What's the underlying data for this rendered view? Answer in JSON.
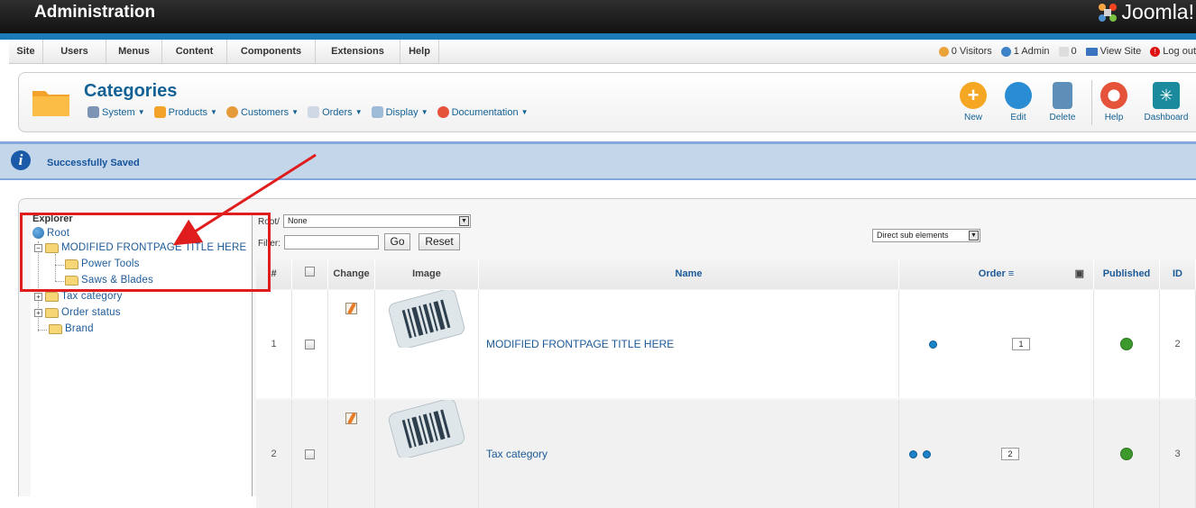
{
  "header": {
    "title": "Administration",
    "logo_text": "Joomla!"
  },
  "menu": {
    "items": [
      "Site",
      "Users",
      "Menus",
      "Content",
      "Components",
      "Extensions",
      "Help"
    ]
  },
  "status": {
    "visitors": "0 Visitors",
    "admins": "1 Admin",
    "messages": "0",
    "view_site": "View Site",
    "logout": "Log out"
  },
  "page": {
    "title": "Categories",
    "submenu": [
      {
        "label": "System",
        "icon": "tools-icon"
      },
      {
        "label": "Products",
        "icon": "products-icon"
      },
      {
        "label": "Customers",
        "icon": "customers-icon"
      },
      {
        "label": "Orders",
        "icon": "orders-icon"
      },
      {
        "label": "Display",
        "icon": "display-icon"
      },
      {
        "label": "Documentation",
        "icon": "help-ring-icon"
      }
    ],
    "toolbar": {
      "new": "New",
      "edit": "Edit",
      "delete": "Delete",
      "help": "Help",
      "dashboard": "Dashboard"
    }
  },
  "message": {
    "text": "Successfully Saved"
  },
  "explorer": {
    "title": "Explorer",
    "root": "Root",
    "nodes": [
      "MODIFIED FRONTPAGE TITLE HERE",
      "Power Tools",
      "Saws & Blades",
      "Tax category",
      "Order status",
      "Brand"
    ]
  },
  "controls": {
    "root_label": "Root/",
    "root_select": "None",
    "filter_label": "Filter:",
    "filter_value": "",
    "go": "Go",
    "reset": "Reset",
    "scope_select": "Direct sub elements"
  },
  "grid": {
    "headers": {
      "num": "#",
      "change": "Change",
      "image": "Image",
      "name": "Name",
      "order": "Order",
      "published": "Published",
      "id": "ID"
    },
    "rows": [
      {
        "num": "1",
        "name": "MODIFIED FRONTPAGE TITLE HERE",
        "order": "1",
        "id": "2"
      },
      {
        "num": "2",
        "name": "Tax category",
        "order": "2",
        "id": "3"
      }
    ]
  },
  "colors": {
    "accent": "#1b7ab8",
    "link": "#1d5a98",
    "annotation": "#e01d1d",
    "message_bg": "#c3d6ea"
  }
}
